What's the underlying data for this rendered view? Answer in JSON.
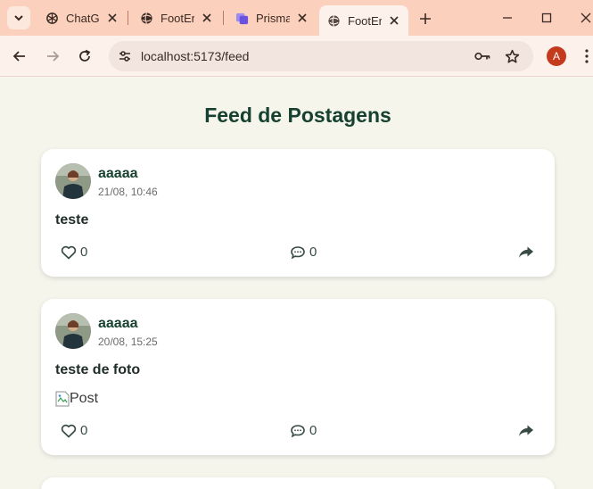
{
  "browser": {
    "tabs": [
      {
        "title": "ChatGPT",
        "icon": "openai-icon"
      },
      {
        "title": "FootEra",
        "icon": "globe-icon"
      },
      {
        "title": "Prisma",
        "icon": "prisma-icon"
      },
      {
        "title": "FootEra",
        "icon": "globe-icon"
      }
    ],
    "url": "localhost:5173/feed",
    "profile_initial": "A",
    "colors": {
      "tabstrip": "#fbd0bc",
      "toolbar": "#fdf1ec",
      "profile": "#c5391c"
    }
  },
  "page": {
    "title": "Feed de Postagens"
  },
  "posts": [
    {
      "author": "aaaaa",
      "time": "21/08, 10:46",
      "text": "teste",
      "likes": "0",
      "comments": "0"
    },
    {
      "author": "aaaaa",
      "time": "20/08, 15:25",
      "text": "teste de foto",
      "image_alt": "Post",
      "likes": "0",
      "comments": "0"
    }
  ]
}
